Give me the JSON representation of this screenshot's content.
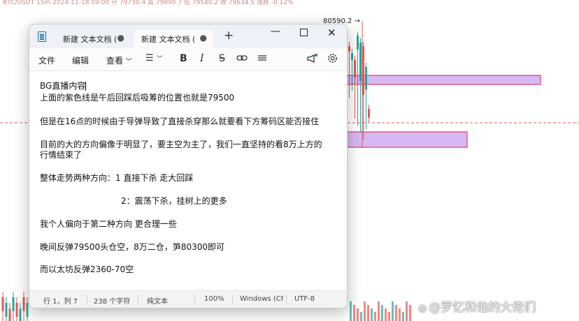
{
  "background_chart": {
    "price_label": "80590.2",
    "header_text": "BTC/USDT 15m 2024-11-18 09:00 开 79730.4 高 79890.7 低 79540.2 收 79634.5 涨跌 -0.12%",
    "colors": {
      "up": "#26a69a",
      "down": "#ef5350",
      "zone": "#d8b7f5",
      "zone_border": "#e0476c"
    }
  },
  "watermark": {
    "text": "@罗忆和他的大佬们"
  },
  "window": {
    "tabs": [
      {
        "label": "新建 文本文档 (",
        "active": false
      },
      {
        "label": "新建 文本文档 (",
        "active": true
      }
    ],
    "add_tab": "+",
    "controls": {
      "minimize": "—",
      "close": "✕"
    }
  },
  "menu": {
    "file": "文件",
    "edit": "编辑",
    "view": "查看"
  },
  "document": {
    "lines": [
      "BG直播内容",
      "上面的紫色线是午后回踩后吸筹的位置也就是79500",
      "",
      "但是在16点的时候由于导弹导致了直接杀穿那么就要看下方筹码区能否接住",
      "",
      "目前的大的方向偏像于明显了，要主空为主了，我们一直坚持的看8万上方的",
      "行情结束了",
      "",
      "整体走势两种方向：1 直接下杀 走大回踩",
      "",
      "2：震荡下杀，挂树上的更多",
      "",
      "我个人偏向于第二种方向 更合理一些",
      "",
      "晚间反弹79500头仓空，8万二仓，笋80300即可",
      "",
      "而以太坊反弹2360-70空"
    ]
  },
  "status": {
    "position": "行 1，列 7",
    "chars": "238 个字符",
    "format": "纯文本",
    "zoom": "100%",
    "line_ending": "Windows (CR",
    "encoding": "UTF-8"
  }
}
